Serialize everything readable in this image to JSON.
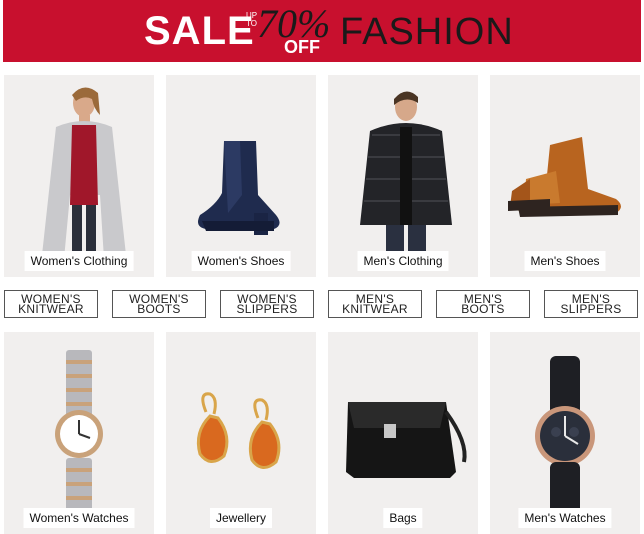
{
  "banner": {
    "sale": "SALE",
    "up_to": "UP TO",
    "percent": "70%",
    "off": "OFF",
    "fashion": "FASHION"
  },
  "tiles_row1": [
    {
      "label": "Women's Clothing",
      "icon": "womens-coat-image"
    },
    {
      "label": "Women's Shoes",
      "icon": "ankle-boot-image"
    },
    {
      "label": "Men's Clothing",
      "icon": "mens-jacket-image"
    },
    {
      "label": "Men's Shoes",
      "icon": "mens-boots-image"
    }
  ],
  "subcategories": [
    {
      "line1": "WOMEN'S",
      "line2": "KNITWEAR"
    },
    {
      "line1": "WOMEN'S",
      "line2": "BOOTS"
    },
    {
      "line1": "WOMEN'S",
      "line2": "SLIPPERS"
    },
    {
      "line1": "MEN'S",
      "line2": "KNITWEAR"
    },
    {
      "line1": "MEN'S",
      "line2": "BOOTS"
    },
    {
      "line1": "MEN'S",
      "line2": "SLIPPERS"
    }
  ],
  "tiles_row2": [
    {
      "label": "Women's Watches",
      "icon": "womens-watch-image"
    },
    {
      "label": "Jewellery",
      "icon": "earrings-image"
    },
    {
      "label": "Bags",
      "icon": "handbag-image"
    },
    {
      "label": "Men's Watches",
      "icon": "mens-watch-image"
    }
  ],
  "colors": {
    "banner_red": "#c8102e",
    "tile_bg": "#f1efee"
  }
}
